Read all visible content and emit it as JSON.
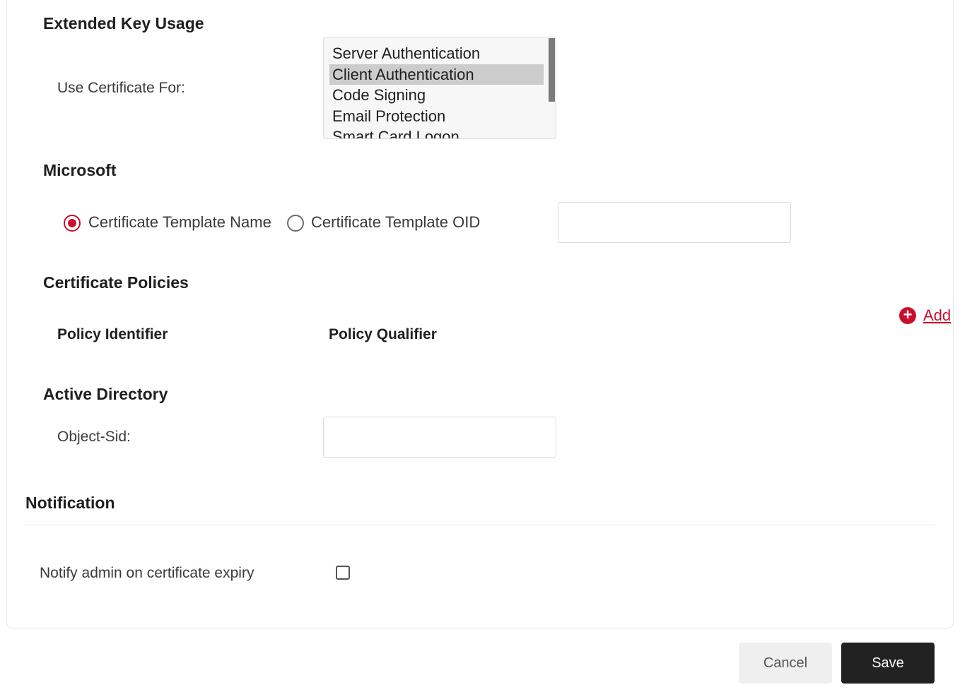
{
  "extended_key_usage": {
    "title": "Extended Key Usage",
    "use_label": "Use Certificate For:",
    "options": [
      {
        "label": "Server Authentication",
        "selected": false
      },
      {
        "label": "Client Authentication",
        "selected": true
      },
      {
        "label": "Code Signing",
        "selected": false
      },
      {
        "label": "Email Protection",
        "selected": false
      },
      {
        "label": "Smart Card Logon",
        "selected": false
      }
    ]
  },
  "microsoft": {
    "title": "Microsoft",
    "radio_name_label": "Certificate Template Name",
    "radio_oid_label": "Certificate Template OID",
    "selected": "Certificate Template Name",
    "template_value": ""
  },
  "certificate_policies": {
    "title": "Certificate Policies",
    "add_label": "Add",
    "col_identifier": "Policy Identifier",
    "col_qualifier": "Policy Qualifier"
  },
  "active_directory": {
    "title": "Active Directory",
    "object_sid_label": "Object-Sid:",
    "object_sid_value": ""
  },
  "notification": {
    "title": "Notification",
    "notify_label": "Notify admin on certificate expiry",
    "notify_checked": false
  },
  "footer": {
    "cancel_label": "Cancel",
    "save_label": "Save"
  },
  "colors": {
    "accent": "#c8102e",
    "primary_button": "#222222",
    "secondary_button": "#efefef"
  }
}
